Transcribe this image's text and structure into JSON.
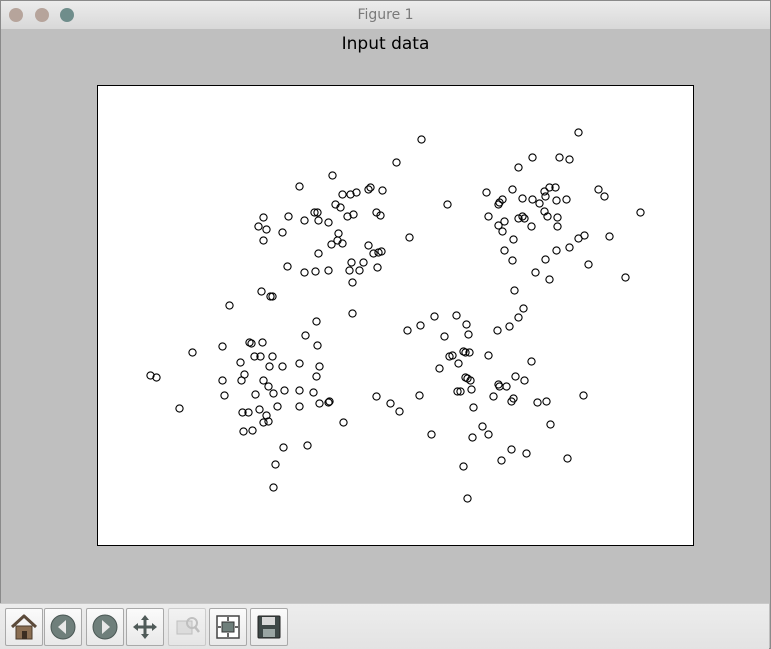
{
  "window": {
    "title": "Figure 1",
    "traffic_lights": [
      "close-button",
      "minimize-button",
      "zoom-button"
    ]
  },
  "toolbar": {
    "buttons": [
      {
        "name": "home",
        "icon": "home-icon",
        "enabled": true
      },
      {
        "name": "back",
        "icon": "back-arrow-icon",
        "enabled": true
      },
      {
        "name": "forward",
        "icon": "forward-arrow-icon",
        "enabled": true
      },
      {
        "name": "pan",
        "icon": "pan-move-icon",
        "enabled": true
      },
      {
        "name": "zoom",
        "icon": "zoom-rect-icon",
        "enabled": false
      },
      {
        "name": "subplots",
        "icon": "subplots-configure-icon",
        "enabled": true
      },
      {
        "name": "save",
        "icon": "save-floppy-icon",
        "enabled": true
      }
    ]
  },
  "chart_data": {
    "type": "scatter",
    "title": "Input data",
    "xlabel": "",
    "ylabel": "",
    "xlim": [
      97,
      693
    ],
    "ylim": [
      545,
      85
    ],
    "axis_ticks": false,
    "grid": false,
    "marker": "open-circle",
    "marker_color": "#000000",
    "series": [
      {
        "points": [
          [
            421,
            139
          ],
          [
            396,
            162
          ],
          [
            332,
            175
          ],
          [
            299,
            186
          ],
          [
            370,
            187
          ],
          [
            368,
            189
          ],
          [
            356,
            192
          ],
          [
            350,
            194
          ],
          [
            342,
            194
          ],
          [
            382,
            190
          ],
          [
            447,
            204
          ],
          [
            317,
            212
          ],
          [
            314,
            212
          ],
          [
            335,
            204
          ],
          [
            340,
            207
          ],
          [
            318,
            220
          ],
          [
            347,
            216
          ],
          [
            353,
            214
          ],
          [
            376,
            212
          ],
          [
            380,
            215
          ],
          [
            263,
            217
          ],
          [
            258,
            226
          ],
          [
            288,
            216
          ],
          [
            304,
            220
          ],
          [
            266,
            229
          ],
          [
            282,
            232
          ],
          [
            328,
            222
          ],
          [
            338,
            233
          ],
          [
            263,
            240
          ],
          [
            331,
            244
          ],
          [
            342,
            243
          ],
          [
            337,
            240
          ],
          [
            409,
            237
          ],
          [
            368,
            245
          ],
          [
            373,
            253
          ],
          [
            381,
            251
          ],
          [
            378,
            252
          ],
          [
            318,
            253
          ],
          [
            351,
            262
          ],
          [
            363,
            262
          ],
          [
            287,
            266
          ],
          [
            377,
            267
          ],
          [
            304,
            272
          ],
          [
            315,
            271
          ],
          [
            328,
            270
          ],
          [
            349,
            270
          ],
          [
            359,
            270
          ],
          [
            261,
            291
          ],
          [
            272,
            296
          ],
          [
            270,
            296
          ],
          [
            229,
            305
          ],
          [
            352,
            282
          ],
          [
            316,
            321
          ],
          [
            305,
            335
          ],
          [
            352,
            313
          ],
          [
            249,
            342
          ],
          [
            251,
            343
          ],
          [
            262,
            342
          ],
          [
            222,
            346
          ],
          [
            240,
            362
          ],
          [
            254,
            356
          ],
          [
            260,
            356
          ],
          [
            272,
            356
          ],
          [
            192,
            352
          ],
          [
            150,
            375
          ],
          [
            156,
            377
          ],
          [
            222,
            380
          ],
          [
            241,
            380
          ],
          [
            244,
            374
          ],
          [
            269,
            366
          ],
          [
            282,
            366
          ],
          [
            299,
            363
          ],
          [
            317,
            345
          ],
          [
            319,
            366
          ],
          [
            263,
            380
          ],
          [
            268,
            386
          ],
          [
            284,
            390
          ],
          [
            179,
            408
          ],
          [
            224,
            395
          ],
          [
            255,
            394
          ],
          [
            273,
            393
          ],
          [
            299,
            390
          ],
          [
            313,
            392
          ],
          [
            319,
            403
          ],
          [
            316,
            376
          ],
          [
            329,
            401
          ],
          [
            328,
            402
          ],
          [
            259,
            409
          ],
          [
            248,
            412
          ],
          [
            242,
            412
          ],
          [
            277,
            406
          ],
          [
            299,
            406
          ],
          [
            343,
            422
          ],
          [
            266,
            415
          ],
          [
            268,
            421
          ],
          [
            243,
            431
          ],
          [
            252,
            430
          ],
          [
            263,
            422
          ],
          [
            283,
            447
          ],
          [
            307,
            445
          ],
          [
            275,
            464
          ],
          [
            273,
            487
          ],
          [
            420,
            325
          ],
          [
            407,
            330
          ],
          [
            434,
            316
          ],
          [
            456,
            315
          ],
          [
            466,
            324
          ],
          [
            468,
            334
          ],
          [
            444,
            336
          ],
          [
            497,
            330
          ],
          [
            509,
            326
          ],
          [
            518,
            317
          ],
          [
            523,
            308
          ],
          [
            514,
            290
          ],
          [
            488,
            355
          ],
          [
            452,
            355
          ],
          [
            449,
            356
          ],
          [
            465,
            352
          ],
          [
            463,
            351
          ],
          [
            469,
            352
          ],
          [
            458,
            363
          ],
          [
            439,
            368
          ],
          [
            465,
            377
          ],
          [
            470,
            380
          ],
          [
            467,
            378
          ],
          [
            531,
            361
          ],
          [
            524,
            380
          ],
          [
            515,
            376
          ],
          [
            471,
            389
          ],
          [
            457,
            391
          ],
          [
            460,
            391
          ],
          [
            498,
            384
          ],
          [
            506,
            386
          ],
          [
            499,
            386
          ],
          [
            493,
            396
          ],
          [
            511,
            401
          ],
          [
            513,
            398
          ],
          [
            583,
            395
          ],
          [
            546,
            401
          ],
          [
            537,
            402
          ],
          [
            550,
            424
          ],
          [
            473,
            407
          ],
          [
            482,
            426
          ],
          [
            390,
            403
          ],
          [
            376,
            396
          ],
          [
            399,
            411
          ],
          [
            419,
            395
          ],
          [
            431,
            434
          ],
          [
            488,
            434
          ],
          [
            472,
            437
          ],
          [
            511,
            449
          ],
          [
            526,
            453
          ],
          [
            501,
            460
          ],
          [
            567,
            458
          ],
          [
            463,
            466
          ],
          [
            467,
            498
          ],
          [
            578,
            132
          ],
          [
            532,
            157
          ],
          [
            518,
            167
          ],
          [
            559,
            157
          ],
          [
            569,
            159
          ],
          [
            512,
            189
          ],
          [
            486,
            192
          ],
          [
            499,
            202
          ],
          [
            498,
            204
          ],
          [
            502,
            199
          ],
          [
            488,
            216
          ],
          [
            504,
            221
          ],
          [
            522,
            198
          ],
          [
            532,
            199
          ],
          [
            545,
            196
          ],
          [
            549,
            187
          ],
          [
            544,
            191
          ],
          [
            555,
            187
          ],
          [
            556,
            200
          ],
          [
            566,
            199
          ],
          [
            598,
            189
          ],
          [
            604,
            196
          ],
          [
            539,
            203
          ],
          [
            544,
            211
          ],
          [
            547,
            216
          ],
          [
            557,
            217
          ],
          [
            522,
            216
          ],
          [
            524,
            218
          ],
          [
            518,
            218
          ],
          [
            498,
            225
          ],
          [
            502,
            231
          ],
          [
            513,
            239
          ],
          [
            531,
            226
          ],
          [
            557,
            226
          ],
          [
            640,
            212
          ],
          [
            609,
            236
          ],
          [
            578,
            238
          ],
          [
            584,
            235
          ],
          [
            569,
            247
          ],
          [
            556,
            250
          ],
          [
            504,
            250
          ],
          [
            512,
            260
          ],
          [
            545,
            259
          ],
          [
            535,
            272
          ],
          [
            549,
            279
          ],
          [
            588,
            264
          ],
          [
            625,
            277
          ]
        ]
      }
    ]
  }
}
